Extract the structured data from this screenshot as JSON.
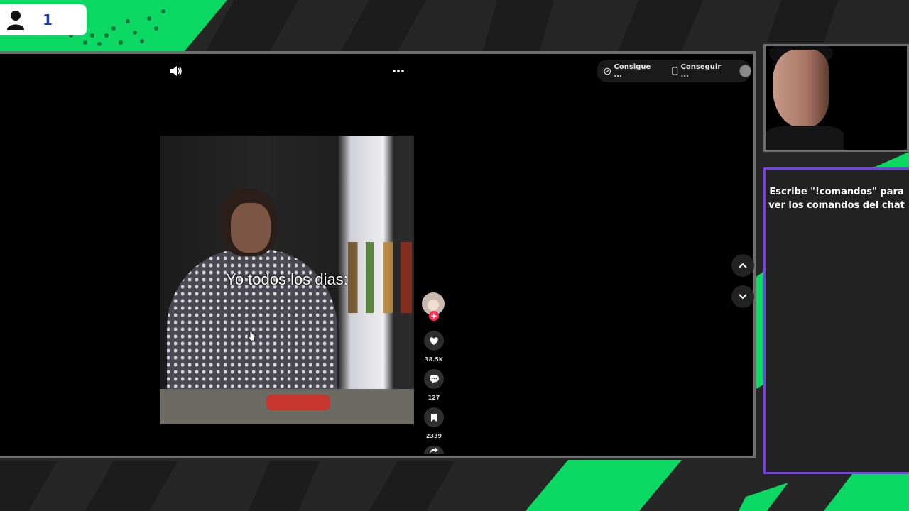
{
  "overlay": {
    "viewer_count": "1"
  },
  "player": {
    "pill_item_1": "Consigue ...",
    "pill_item_2": "Conseguir ...",
    "video_caption": "Yo todos los dias:",
    "likes": "38.5K",
    "comments": "127",
    "saves": "2339"
  },
  "chat": {
    "message": "Escribe \"!comandos\" para ver los comandos del chat"
  },
  "colors": {
    "accent_green": "#0bd964",
    "chat_border": "#7b3ff2",
    "follow_red": "#fe2c55",
    "viewer_count": "#1d39b5"
  }
}
